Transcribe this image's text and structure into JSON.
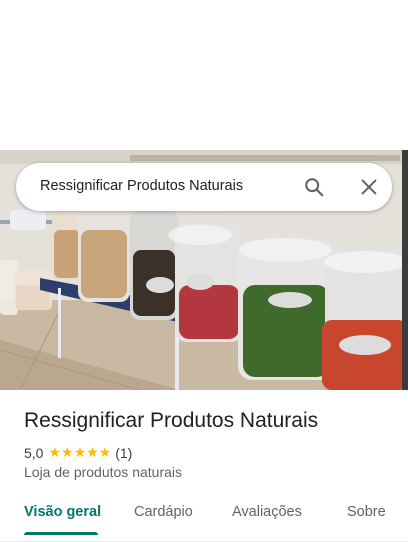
{
  "search": {
    "query": "Ressignificar Produtos Naturais",
    "search_icon": "search-icon",
    "close_icon": "close-icon"
  },
  "hero": {
    "image_icon": "photo-image"
  },
  "place": {
    "name": "Ressignificar Produtos Naturais",
    "rating": "5,0",
    "stars": "★★★★★",
    "review_count": "(1)",
    "category": "Loja de produtos naturais",
    "star_color": "#fbbc04"
  },
  "tabs": [
    {
      "label": "Visão geral",
      "active": true
    },
    {
      "label": "Cardápio",
      "active": false
    },
    {
      "label": "Avaliações",
      "active": false
    },
    {
      "label": "Sobre",
      "active": false
    }
  ],
  "colors": {
    "accent": "#00796b"
  }
}
